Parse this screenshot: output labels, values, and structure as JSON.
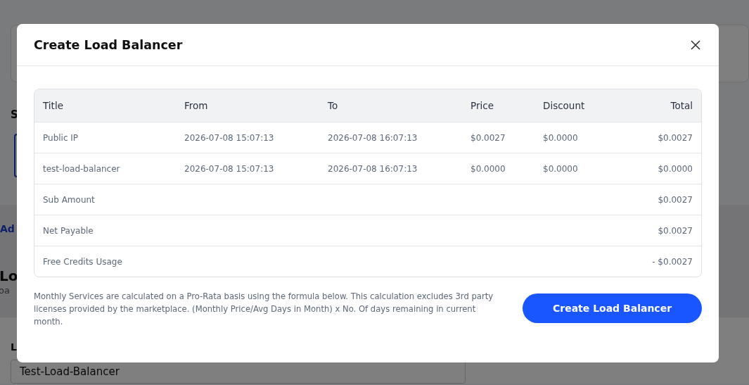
{
  "page": {
    "section_heading": "S",
    "add_link": "Ad",
    "heading": "Lo",
    "subheading": "oa",
    "field_label": "L",
    "field_value": "Test-Load-Balancer"
  },
  "modal": {
    "title": "Create Load Balancer",
    "table": {
      "columns": [
        "Title",
        "From",
        "To",
        "Price",
        "Discount",
        "Total"
      ],
      "rows": [
        {
          "kind": "item",
          "cells": [
            "Public IP",
            "2026-07-08 15:07:13",
            "2026-07-08 16:07:13",
            "$0.0027",
            "$0.0000",
            "$0.0027"
          ]
        },
        {
          "kind": "item",
          "cells": [
            "test-load-balancer",
            "2026-07-08 15:07:13",
            "2026-07-08 16:07:13",
            "$0.0000",
            "$0.0000",
            "$0.0000"
          ]
        },
        {
          "kind": "summary",
          "label": "Sub Amount",
          "total": "$0.0027"
        },
        {
          "kind": "summary",
          "label": "Net Payable",
          "total": "$0.0027"
        },
        {
          "kind": "summary",
          "label": "Free Credits Usage",
          "total": "- $0.0027"
        }
      ]
    },
    "note": "Monthly Services are calculated on a Pro-Rata basis using the formula below. This calculation excludes 3rd party licenses provided by the marketplace. (Monthly Price/Avg Days in Month) x No. Of days remaining in current month.",
    "button": "Create Load Balancer"
  }
}
